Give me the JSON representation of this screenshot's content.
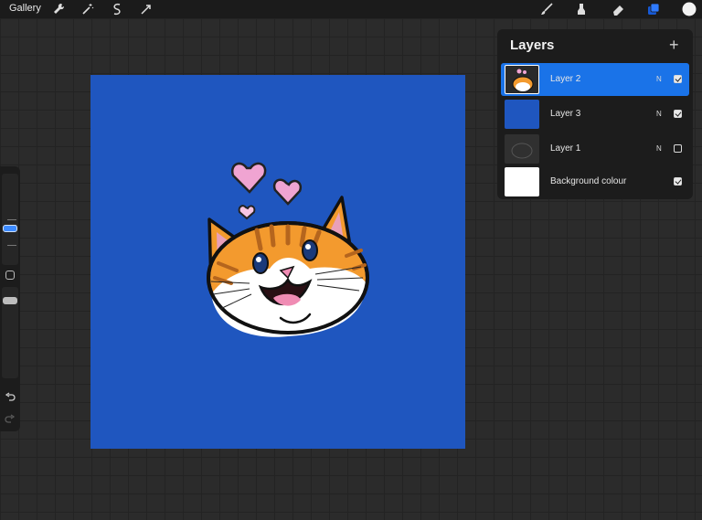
{
  "topbar": {
    "gallery_label": "Gallery",
    "left_tools": [
      "wrench-icon",
      "magic-wand-icon",
      "selection-icon",
      "transform-icon"
    ],
    "right_tools": [
      "brush-icon",
      "smudge-icon",
      "eraser-icon",
      "layers-icon",
      "color-swatch-icon"
    ],
    "active_color": "#f2f2f2"
  },
  "sidebar": {
    "icons": [
      "undo-icon",
      "redo-icon",
      "modify-square-icon"
    ]
  },
  "canvas": {
    "background_color": "#1f56bf"
  },
  "layers_panel": {
    "title": "Layers",
    "add_icon": "plus-icon",
    "layers": [
      {
        "name": "Layer 2",
        "blend": "N",
        "visible": true,
        "active": true
      },
      {
        "name": "Layer 3",
        "blend": "N",
        "visible": true,
        "active": false
      },
      {
        "name": "Layer 1",
        "blend": "N",
        "visible": false,
        "active": false
      },
      {
        "name": "Background colour",
        "blend": "",
        "visible": true,
        "active": false
      }
    ]
  },
  "colors": {
    "accent": "#1a73e8",
    "panel": "#1c1c1c",
    "canvas_blue": "#1f56bf"
  }
}
